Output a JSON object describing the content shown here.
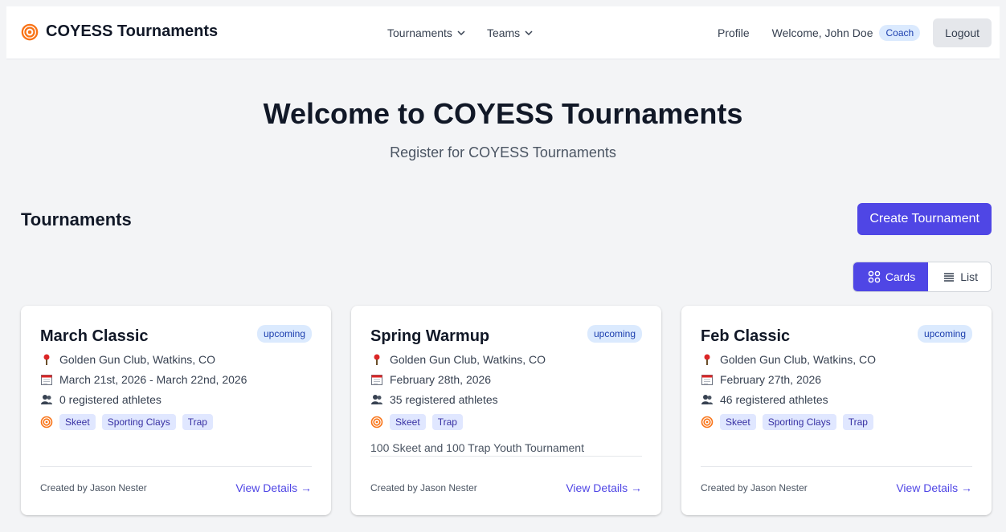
{
  "header": {
    "brand_title": "COYESS Tournaments",
    "brand_icon": "target-icon",
    "nav": [
      {
        "label": "Tournaments"
      },
      {
        "label": "Teams"
      }
    ],
    "profile_label": "Profile",
    "welcome_text": "Welcome, John Doe",
    "role_badge": "Coach",
    "logout_label": "Logout"
  },
  "hero": {
    "title": "Welcome to COYESS Tournaments",
    "subtitle": "Register for COYESS Tournaments"
  },
  "section": {
    "title": "Tournaments",
    "create_label": "Create Tournament",
    "view_toggle": {
      "cards_label": "Cards",
      "list_label": "List",
      "selected": "Cards"
    }
  },
  "tournaments": [
    {
      "title": "March Classic",
      "status": "upcoming",
      "location": "Golden Gun Club, Watkins, CO",
      "dates": "March 21st, 2026 - March 22nd, 2026",
      "athletes": "0 registered athletes",
      "disciplines": [
        "Skeet",
        "Sporting Clays",
        "Trap"
      ],
      "description": "",
      "created_by": "Created by Jason Nester",
      "details_label": "View Details →"
    },
    {
      "title": "Spring Warmup",
      "status": "upcoming",
      "location": "Golden Gun Club, Watkins, CO",
      "dates": "February 28th, 2026",
      "athletes": "35 registered athletes",
      "disciplines": [
        "Skeet",
        "Trap"
      ],
      "description": "100 Skeet and 100 Trap Youth Tournament",
      "created_by": "Created by Jason Nester",
      "details_label": "View Details →"
    },
    {
      "title": "Feb Classic",
      "status": "upcoming",
      "location": "Golden Gun Club, Watkins, CO",
      "dates": "February 27th, 2026",
      "athletes": "46 registered athletes",
      "disciplines": [
        "Skeet",
        "Sporting Clays",
        "Trap"
      ],
      "description": "",
      "created_by": "Created by Jason Nester",
      "details_label": "View Details →"
    }
  ],
  "colors": {
    "accent": "#4f46e5",
    "badge_bg": "#dbeafe",
    "badge_text": "#1e40af",
    "tag_bg": "#e0e7ff"
  }
}
